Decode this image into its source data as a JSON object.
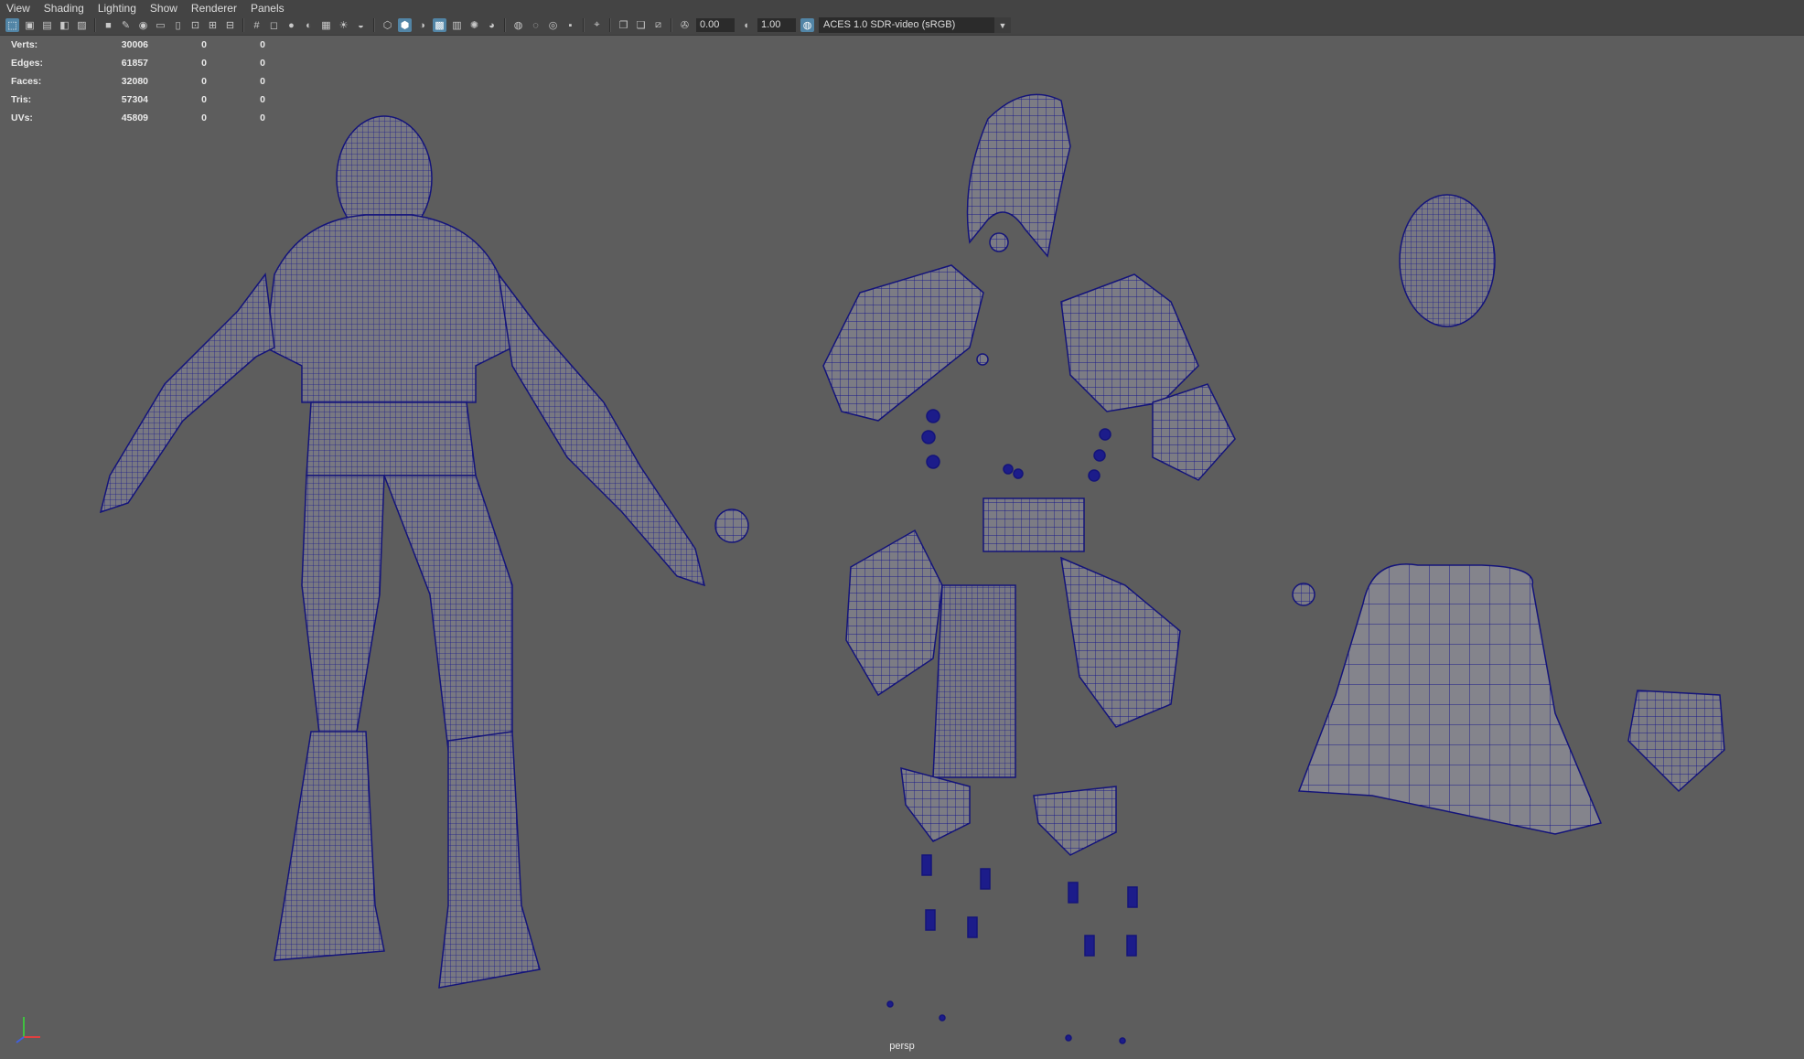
{
  "menubar": {
    "items": [
      "View",
      "Shading",
      "Lighting",
      "Show",
      "Renderer",
      "Panels"
    ]
  },
  "toolbar": {
    "exposure_value": "0.00",
    "gamma_value": "1.00",
    "color_management": "ACES 1.0 SDR-video (sRGB)"
  },
  "hud": {
    "rows": [
      {
        "label": "Verts:",
        "v1": "30006",
        "v2": "0",
        "v3": "0"
      },
      {
        "label": "Edges:",
        "v1": "61857",
        "v2": "0",
        "v3": "0"
      },
      {
        "label": "Faces:",
        "v1": "32080",
        "v2": "0",
        "v3": "0"
      },
      {
        "label": "Tris:",
        "v1": "57304",
        "v2": "0",
        "v3": "0"
      },
      {
        "label": "UVs:",
        "v1": "45809",
        "v2": "0",
        "v3": "0"
      }
    ]
  },
  "viewport": {
    "camera": "persp",
    "background_color": "#5d5d5d",
    "wireframe_color": "#1c1c8a",
    "shaded_color": "#7c7c84"
  },
  "axis_gizmo": {
    "x_color": "#e04040",
    "y_color": "#40c040",
    "z_color": "#4060e0"
  }
}
